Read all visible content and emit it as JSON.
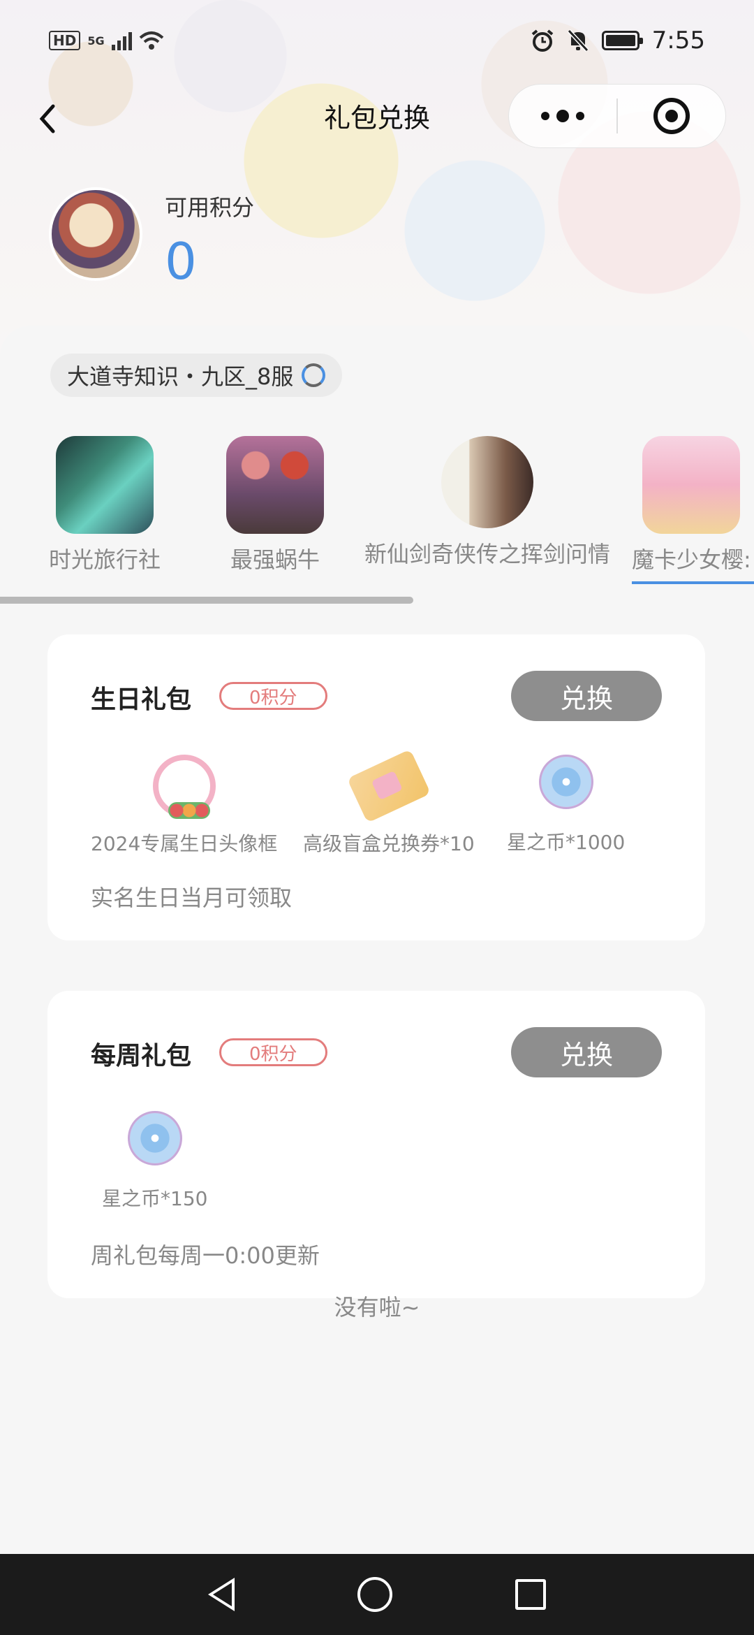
{
  "status_bar": {
    "hd": "HD",
    "network": "5G",
    "time": "7:55"
  },
  "nav": {
    "title": "礼包兑换"
  },
  "points": {
    "label": "可用积分",
    "value": "0"
  },
  "server": {
    "name": "大道寺知识・九区_8服"
  },
  "games": [
    {
      "name": "时光旅行社"
    },
    {
      "name": "最强蜗牛"
    },
    {
      "name": "新仙剑奇侠传之挥剑问情"
    },
    {
      "name": "魔卡少女樱:"
    }
  ],
  "packs": [
    {
      "title": "生日礼包",
      "cost": "0积分",
      "button": "兑换",
      "items": [
        {
          "label": "2024专属生日头像框",
          "icon": "avatar-frame-icon"
        },
        {
          "label": "高级盲盒兑换券*10",
          "icon": "ticket-icon"
        },
        {
          "label": "星之币*1000",
          "icon": "star-coin-icon"
        }
      ],
      "note": "实名生日当月可领取"
    },
    {
      "title": "每周礼包",
      "cost": "0积分",
      "button": "兑换",
      "items": [
        {
          "label": "星之币*150",
          "icon": "star-coin-icon"
        }
      ],
      "note": "周礼包每周一0:00更新"
    }
  ],
  "end_text": "没有啦~",
  "colors": {
    "accent": "#4a90e2",
    "badge": "#e37c7c",
    "button": "#8e8e8e"
  }
}
